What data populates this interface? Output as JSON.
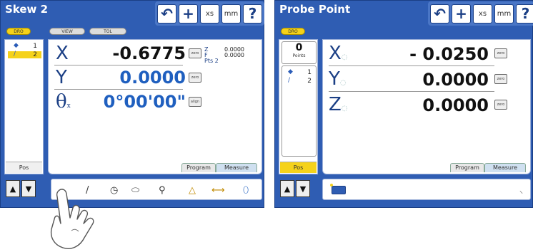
{
  "left_screen": {
    "title": "Skew 2",
    "toolbar": {
      "undo_icon": "undo-icon",
      "plus_icon": "plus-icon",
      "xs": "xs",
      "mm": "mm",
      "help": "?"
    },
    "mode_buttons": [
      "DRO",
      "VIEW",
      "TOL"
    ],
    "features": [
      {
        "num": "1"
      },
      {
        "num": "2"
      }
    ],
    "pos": "Pos",
    "readouts": [
      {
        "axis": "X",
        "value": "-0.6775",
        "color": "#111111",
        "btn": "zero"
      },
      {
        "axis": "Y",
        "value": "0.0000",
        "color": "#1f5fbf",
        "btn": "zero"
      },
      {
        "axis": "θ",
        "axis_sub": "x",
        "value": "0°00'00\"",
        "color": "#1f5fbf",
        "btn": "align"
      }
    ],
    "info": {
      "z_label": "Z",
      "z_value": "0.0000",
      "f_label": "F",
      "f_value": "0.0000",
      "pts": "Pts 2"
    },
    "tabs": [
      "Program",
      "Measure"
    ],
    "bottom_tools": [
      "point-tool",
      "line-tool",
      "circle-tool",
      "slot-tool",
      "probe-tool",
      "angle-tool",
      "distance-tool",
      "skew-tool"
    ]
  },
  "right_screen": {
    "title": "Probe Point",
    "toolbar": {
      "undo_icon": "undo-icon",
      "plus_icon": "plus-icon",
      "xs": "xs",
      "mm": "mm",
      "help": "?"
    },
    "mode_buttons": [
      "DRO"
    ],
    "points_count": "0",
    "points_label": "Points",
    "features": [
      {
        "num": "1"
      },
      {
        "num": "2"
      }
    ],
    "pos": "Pos",
    "readouts": [
      {
        "axis": "X",
        "value": "- 0.0250"
      },
      {
        "axis": "Y",
        "value": "0.0000"
      },
      {
        "axis": "Z",
        "value": "0.0000"
      }
    ],
    "btn": "zero",
    "tabs": [
      "Program",
      "Measure"
    ]
  },
  "colors": {
    "frame": "#2f5db3",
    "accent_yellow": "#f5d21a",
    "value_blue": "#1f5fbf"
  }
}
